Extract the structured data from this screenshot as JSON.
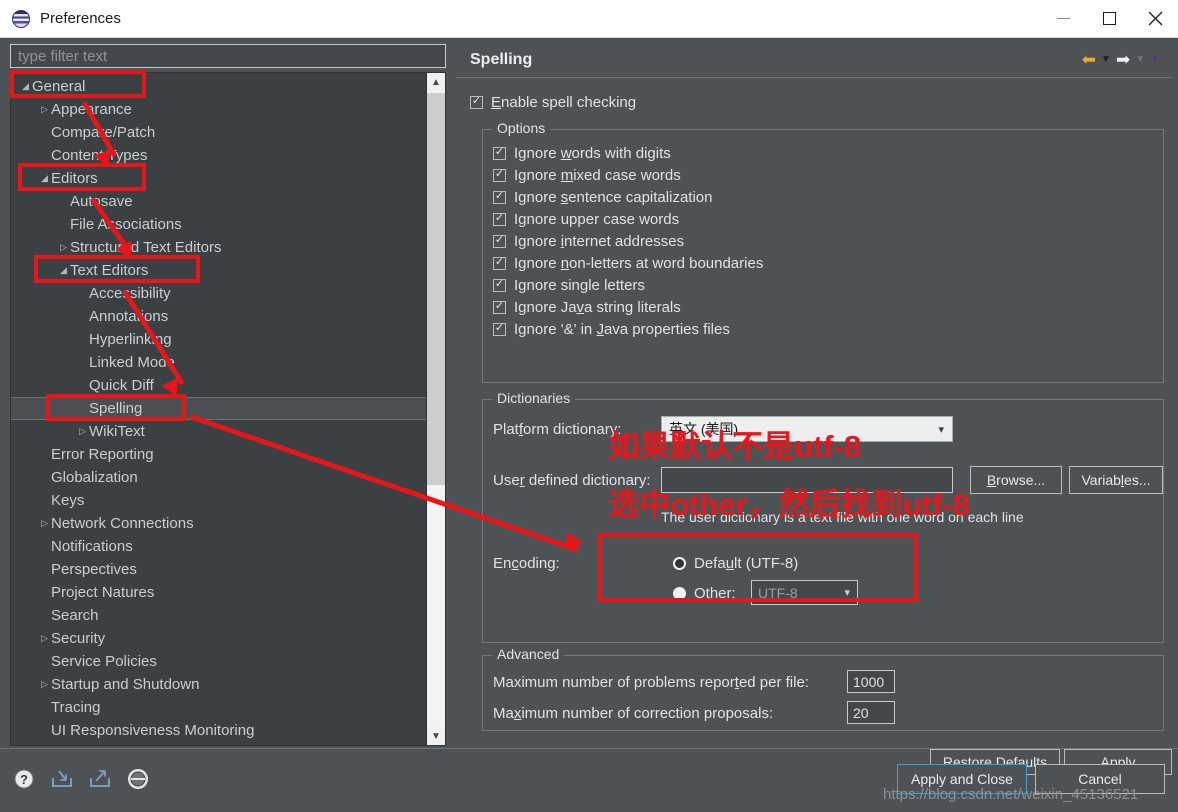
{
  "window": {
    "title": "Preferences",
    "app_icon": "eclipse-icon",
    "controls": {
      "minimize": "minimize-icon",
      "maximize": "maximize-icon",
      "close": "close-icon"
    }
  },
  "filter": {
    "placeholder": "type filter text",
    "value": ""
  },
  "tree": {
    "items": [
      {
        "label": "General",
        "indent": 0,
        "twisty": "expanded",
        "selected": false
      },
      {
        "label": "Appearance",
        "indent": 1,
        "twisty": "collapsed",
        "selected": false
      },
      {
        "label": "Compare/Patch",
        "indent": 1,
        "twisty": "none",
        "selected": false
      },
      {
        "label": "Content Types",
        "indent": 1,
        "twisty": "none",
        "selected": false
      },
      {
        "label": "Editors",
        "indent": 1,
        "twisty": "expanded",
        "selected": false
      },
      {
        "label": "Autosave",
        "indent": 2,
        "twisty": "none",
        "selected": false
      },
      {
        "label": "File Associations",
        "indent": 2,
        "twisty": "none",
        "selected": false
      },
      {
        "label": "Structured Text Editors",
        "indent": 2,
        "twisty": "collapsed",
        "selected": false
      },
      {
        "label": "Text Editors",
        "indent": 2,
        "twisty": "expanded",
        "selected": false
      },
      {
        "label": "Accessibility",
        "indent": 3,
        "twisty": "none",
        "selected": false
      },
      {
        "label": "Annotations",
        "indent": 3,
        "twisty": "none",
        "selected": false
      },
      {
        "label": "Hyperlinking",
        "indent": 3,
        "twisty": "none",
        "selected": false
      },
      {
        "label": "Linked Mode",
        "indent": 3,
        "twisty": "none",
        "selected": false
      },
      {
        "label": "Quick Diff",
        "indent": 3,
        "twisty": "none",
        "selected": false
      },
      {
        "label": "Spelling",
        "indent": 3,
        "twisty": "none",
        "selected": true
      },
      {
        "label": "WikiText",
        "indent": 3,
        "twisty": "collapsed",
        "selected": false
      },
      {
        "label": "Error Reporting",
        "indent": 1,
        "twisty": "none",
        "selected": false
      },
      {
        "label": "Globalization",
        "indent": 1,
        "twisty": "none",
        "selected": false
      },
      {
        "label": "Keys",
        "indent": 1,
        "twisty": "none",
        "selected": false
      },
      {
        "label": "Network Connections",
        "indent": 1,
        "twisty": "collapsed",
        "selected": false
      },
      {
        "label": "Notifications",
        "indent": 1,
        "twisty": "none",
        "selected": false
      },
      {
        "label": "Perspectives",
        "indent": 1,
        "twisty": "none",
        "selected": false
      },
      {
        "label": "Project Natures",
        "indent": 1,
        "twisty": "none",
        "selected": false
      },
      {
        "label": "Search",
        "indent": 1,
        "twisty": "none",
        "selected": false
      },
      {
        "label": "Security",
        "indent": 1,
        "twisty": "collapsed",
        "selected": false
      },
      {
        "label": "Service Policies",
        "indent": 1,
        "twisty": "none",
        "selected": false
      },
      {
        "label": "Startup and Shutdown",
        "indent": 1,
        "twisty": "collapsed",
        "selected": false
      },
      {
        "label": "Tracing",
        "indent": 1,
        "twisty": "none",
        "selected": false
      },
      {
        "label": "UI Responsiveness Monitoring",
        "indent": 1,
        "twisty": "none",
        "selected": false
      }
    ]
  },
  "page": {
    "title": "Spelling",
    "nav": {
      "back": "back-arrow-icon",
      "back_menu": "caret-down-icon",
      "forward": "forward-arrow-icon",
      "forward_menu": "caret-down-icon",
      "view_menu": "caret-down-icon"
    },
    "enable": {
      "label": "Enable spell checking",
      "mnemonic": "E",
      "checked": true
    },
    "options": {
      "legend": "Options",
      "items": [
        {
          "pre": "Ignore ",
          "mn": "w",
          "post": "ords with digits",
          "checked": true
        },
        {
          "pre": "Ignore ",
          "mn": "m",
          "post": "ixed case words",
          "checked": true
        },
        {
          "pre": "Ignore ",
          "mn": "s",
          "post": "entence capitalization",
          "checked": true
        },
        {
          "pre": "Ignore upper case words",
          "mn": "",
          "post": "",
          "checked": true
        },
        {
          "pre": "Ignore ",
          "mn": "i",
          "post": "nternet addresses",
          "checked": true
        },
        {
          "pre": "Ignore ",
          "mn": "n",
          "post": "on-letters at word boundaries",
          "checked": true
        },
        {
          "pre": "I",
          "mn": "g",
          "post": "nore single letters",
          "checked": true
        },
        {
          "pre": "Ignore Ja",
          "mn": "v",
          "post": "a string literals",
          "checked": true
        },
        {
          "pre": "Ignore '&' in ",
          "mn": "J",
          "post": "ava properties files",
          "checked": true
        }
      ]
    },
    "dictionaries": {
      "legend": "Dictionaries",
      "platform_label": "Platform dictionary:",
      "platform_mnemonic": "f",
      "platform_value": "英文 (美国)",
      "user_label": "User defined dictionary:",
      "user_mnemonic": "r",
      "user_value": "",
      "browse_label": "Browse...",
      "browse_mnemonic": "B",
      "variables_label": "Variables...",
      "variables_mnemonic": "l",
      "hint": "The user dictionary is a text file with one word on each line",
      "encoding_label": "Encoding:",
      "encoding_mnemonic": "c",
      "encoding_default_label": "Default (UTF-8)",
      "encoding_default_mnemonic": "u",
      "encoding_default_selected": true,
      "encoding_other_label": "Other:",
      "encoding_other_mnemonic": "O",
      "encoding_other_selected": false,
      "encoding_other_value": "UTF-8"
    },
    "advanced": {
      "legend": "Advanced",
      "max_problems_label": "Maximum number of problems reported per file:",
      "max_problems_mnemonic": "t",
      "max_problems_value": "1000",
      "max_proposals_label": "Maximum number of correction proposals:",
      "max_proposals_mnemonic": "x",
      "max_proposals_value": "20"
    },
    "restore_defaults_label": "Restore Defaults",
    "restore_defaults_mnemonic": "D",
    "apply_label": "Apply",
    "apply_mnemonic": "A"
  },
  "footer": {
    "help_icon": "help-icon",
    "import_icon": "import-icon",
    "export_icon": "export-icon",
    "extra_icon": "eclipse-marketplace-icon",
    "apply_and_close_label": "Apply and Close",
    "cancel_label": "Cancel"
  },
  "annotations": {
    "text_top": "如果默认不是utf-8",
    "text_bottom": "选中other，然后找到utf-8",
    "color": "#e8161b"
  },
  "watermark": "https://blog.csdn.net/weixin_45136521"
}
